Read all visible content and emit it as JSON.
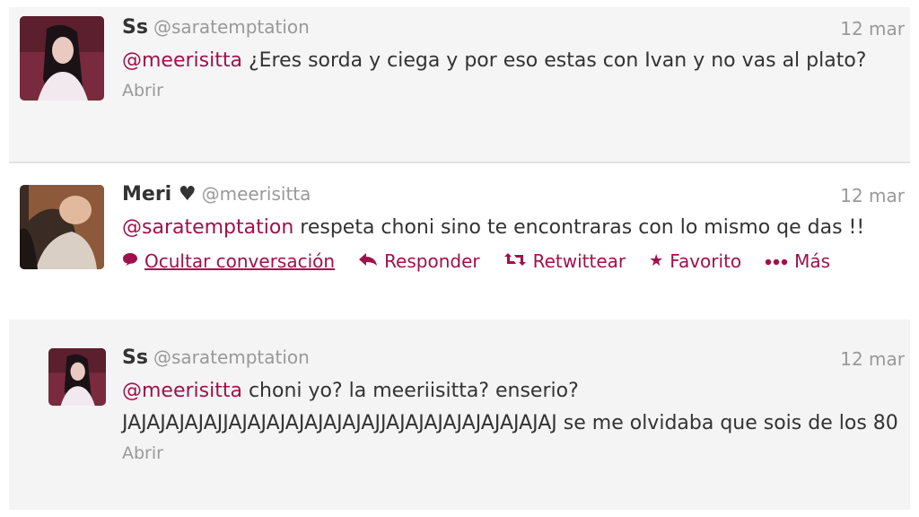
{
  "tweets": [
    {
      "name": "Ss",
      "handle": "@saratemptation",
      "time": "12 mar",
      "mention": "@meerisitta",
      "text": " ¿Eres sorda y ciega y por eso estas con Ivan y no vas al plato?",
      "open_label": "Abrir"
    },
    {
      "name": "Meri ♥",
      "handle": "@meerisitta",
      "time": "12 mar",
      "mention": "@saratemptation",
      "text": " respeta choni sino te encontraras con lo mismo qe das !!",
      "actions": {
        "hide": "Ocultar conversación",
        "reply": "Responder",
        "retweet": "Retwittear",
        "favorite": "Favorito",
        "more": "Más"
      }
    },
    {
      "name": "Ss",
      "handle": "@saratemptation",
      "time": "12 mar",
      "mention": "@meerisitta",
      "text": " choni yo? la meeriisitta? enserio? JAJAJAJAJAJJAJAJAJAJAJAJAJAJJAJAJAJAJAJAJAJAJAJ se me olvidaba que sois de los 80",
      "open_label": "Abrir"
    }
  ],
  "colors": {
    "link": "#a0104c",
    "muted": "#999999",
    "text": "#333333"
  },
  "icons": {
    "hide": "speech-bubble-icon",
    "reply": "reply-arrow-icon",
    "retweet": "retweet-icon",
    "favorite": "star-icon",
    "more": "more-dots-icon"
  }
}
